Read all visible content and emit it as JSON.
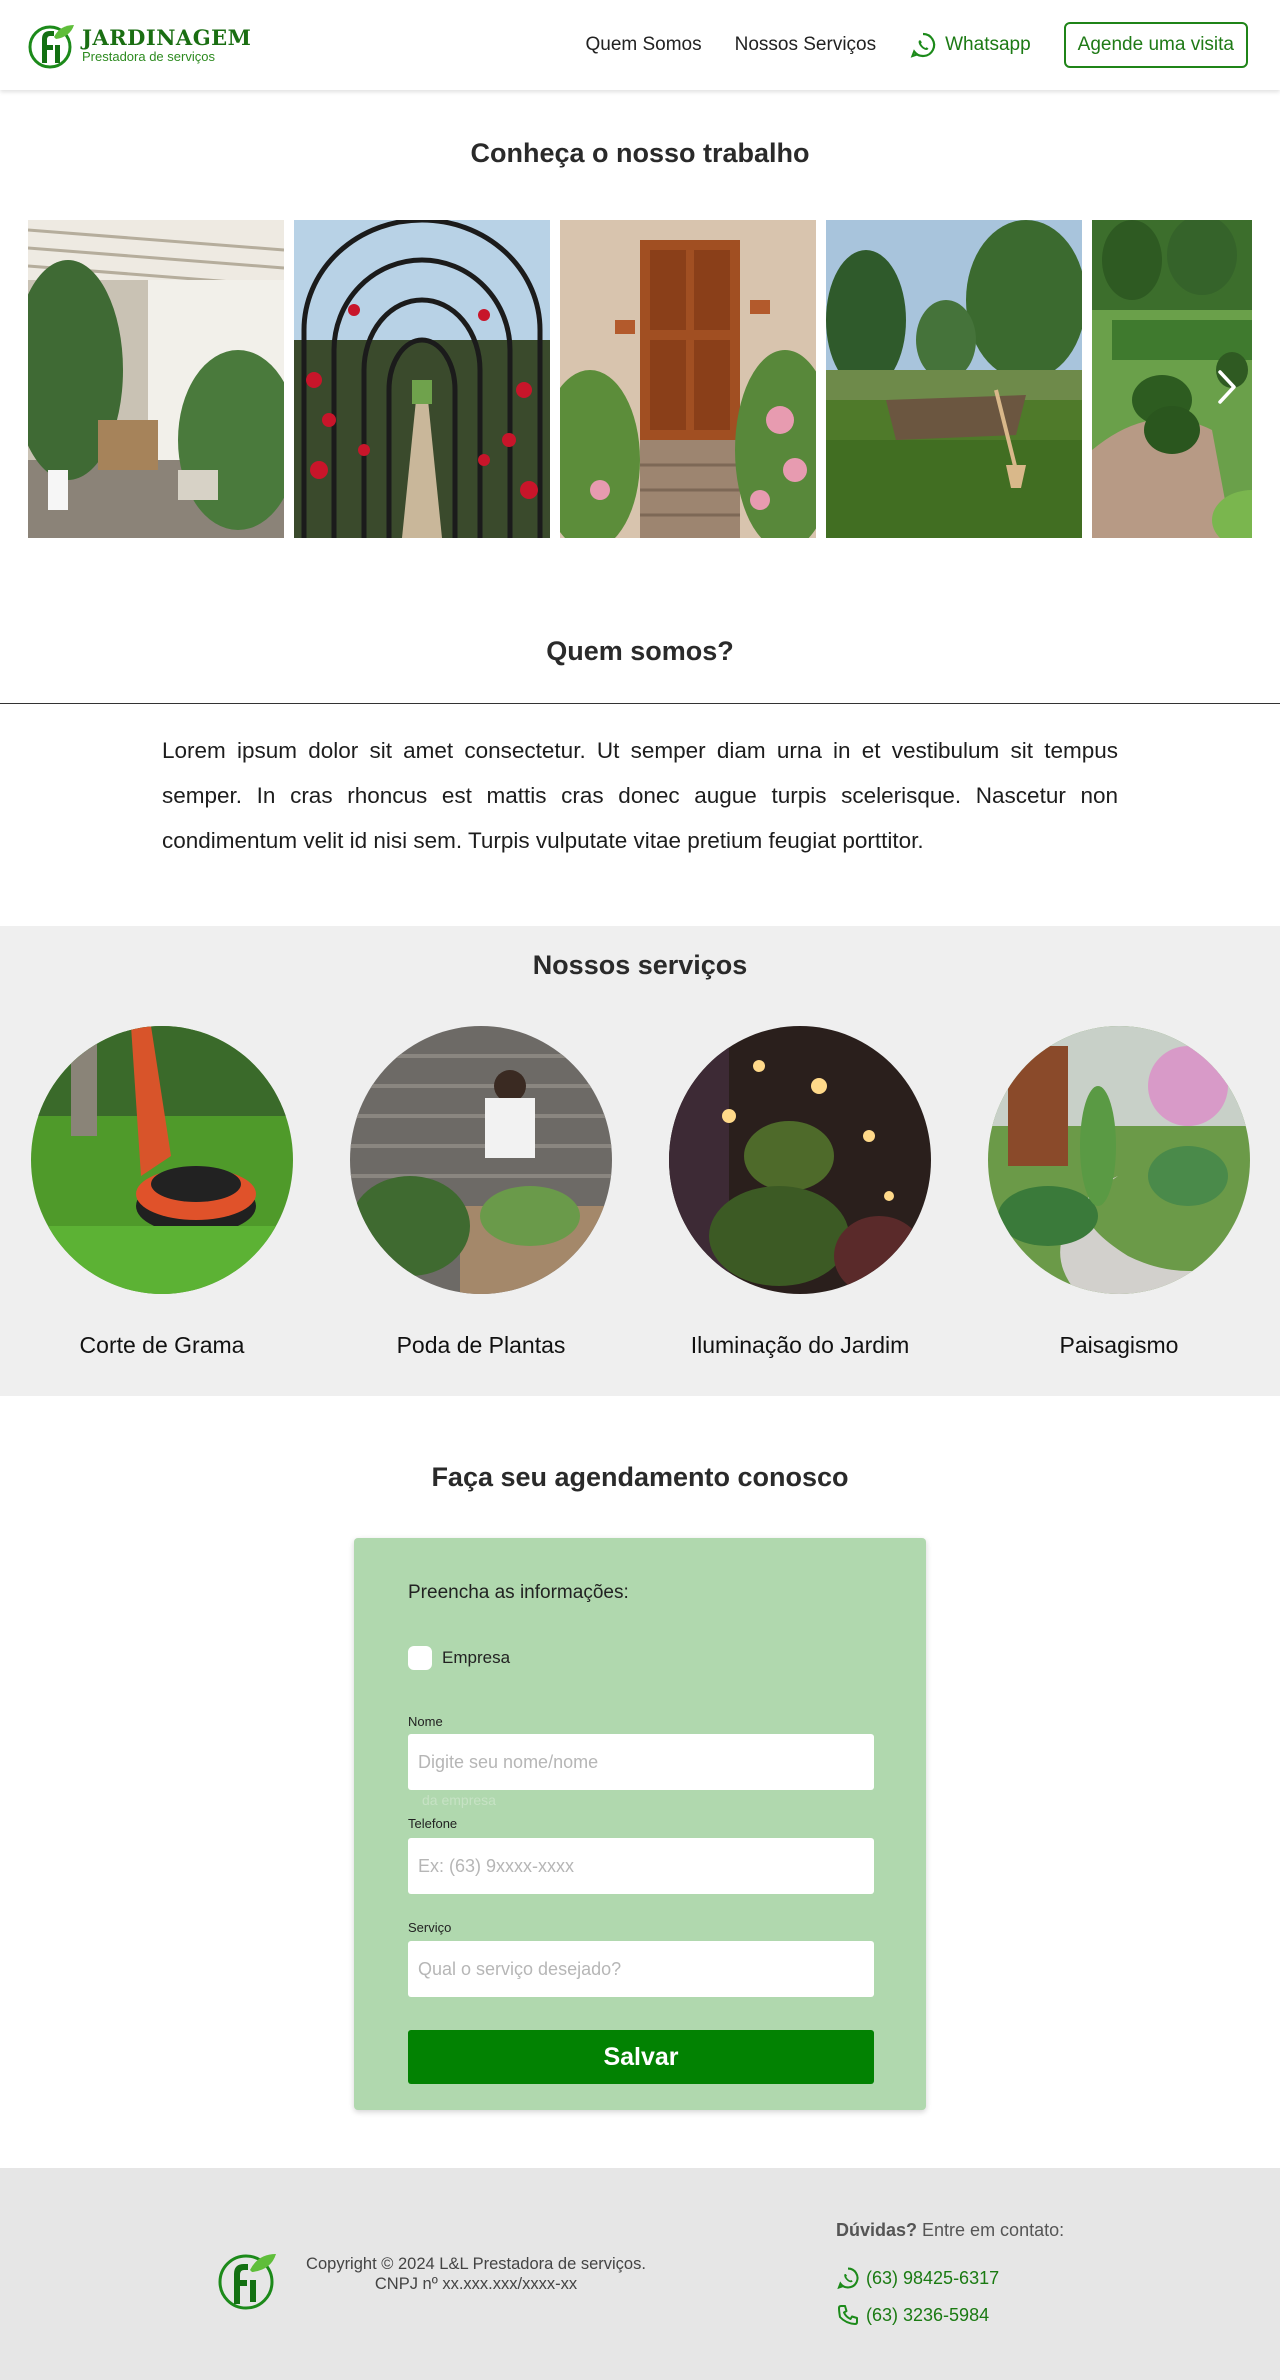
{
  "header": {
    "logo": {
      "brand": "JARDINAGEM",
      "tagline": "Prestadora de serviços"
    },
    "nav": {
      "quem_somos": "Quem Somos",
      "nossos_servicos": "Nossos Serviços",
      "whatsapp": "Whatsapp",
      "cta": "Agende uma visita"
    }
  },
  "gallery": {
    "title": "Conheça o nosso trabalho",
    "images": [
      "pergola-patio",
      "rose-arch-walkway",
      "wooden-door-hydrangeas",
      "garden-lawn-with-rake",
      "topiary-garden"
    ],
    "next_icon": "chevron-right-icon"
  },
  "about": {
    "title": "Quem somos?",
    "text": "Lorem ipsum dolor sit amet consectetur. Ut semper diam urna in et vestibulum sit tempus semper. In cras rhoncus est mattis cras donec augue turpis scelerisque. Nascetur non condimentum velit id nisi sem. Turpis vulputate vitae pretium feugiat porttitor."
  },
  "services": {
    "title": "Nossos serviços",
    "items": [
      {
        "label": "Corte de Grama"
      },
      {
        "label": "Poda de Plantas"
      },
      {
        "label": "Iluminação do Jardim"
      },
      {
        "label": "Paisagismo"
      }
    ]
  },
  "form": {
    "section_title": "Faça seu agendamento conosco",
    "title": "Preencha as informações:",
    "checkbox_label": "Empresa",
    "nome_label": "Nome",
    "nome_placeholder": "Digite seu nome/nome",
    "ghost_text": "da empresa",
    "telefone_label": "Telefone",
    "telefone_placeholder": "Ex: (63) 9xxxx-xxxx",
    "servico_label": "Serviço",
    "servico_placeholder": "Qual o serviço desejado?",
    "submit": "Salvar"
  },
  "footer": {
    "copyright": "Copyright © 2024 L&L Prestadora de serviços.",
    "cnpj": "CNPJ nº xx.xxx.xxx/xxxx-xx",
    "contact_bold": "Dúvidas?",
    "contact_rest": " Entre em contato:",
    "whatsapp_phone": "(63) 98425-6317",
    "phone": "(63) 3236-5984"
  },
  "colors": {
    "brand_green": "#028202",
    "form_bg": "#b0d8ae",
    "services_bg": "#efefef",
    "footer_bg": "#e6e6e6"
  }
}
